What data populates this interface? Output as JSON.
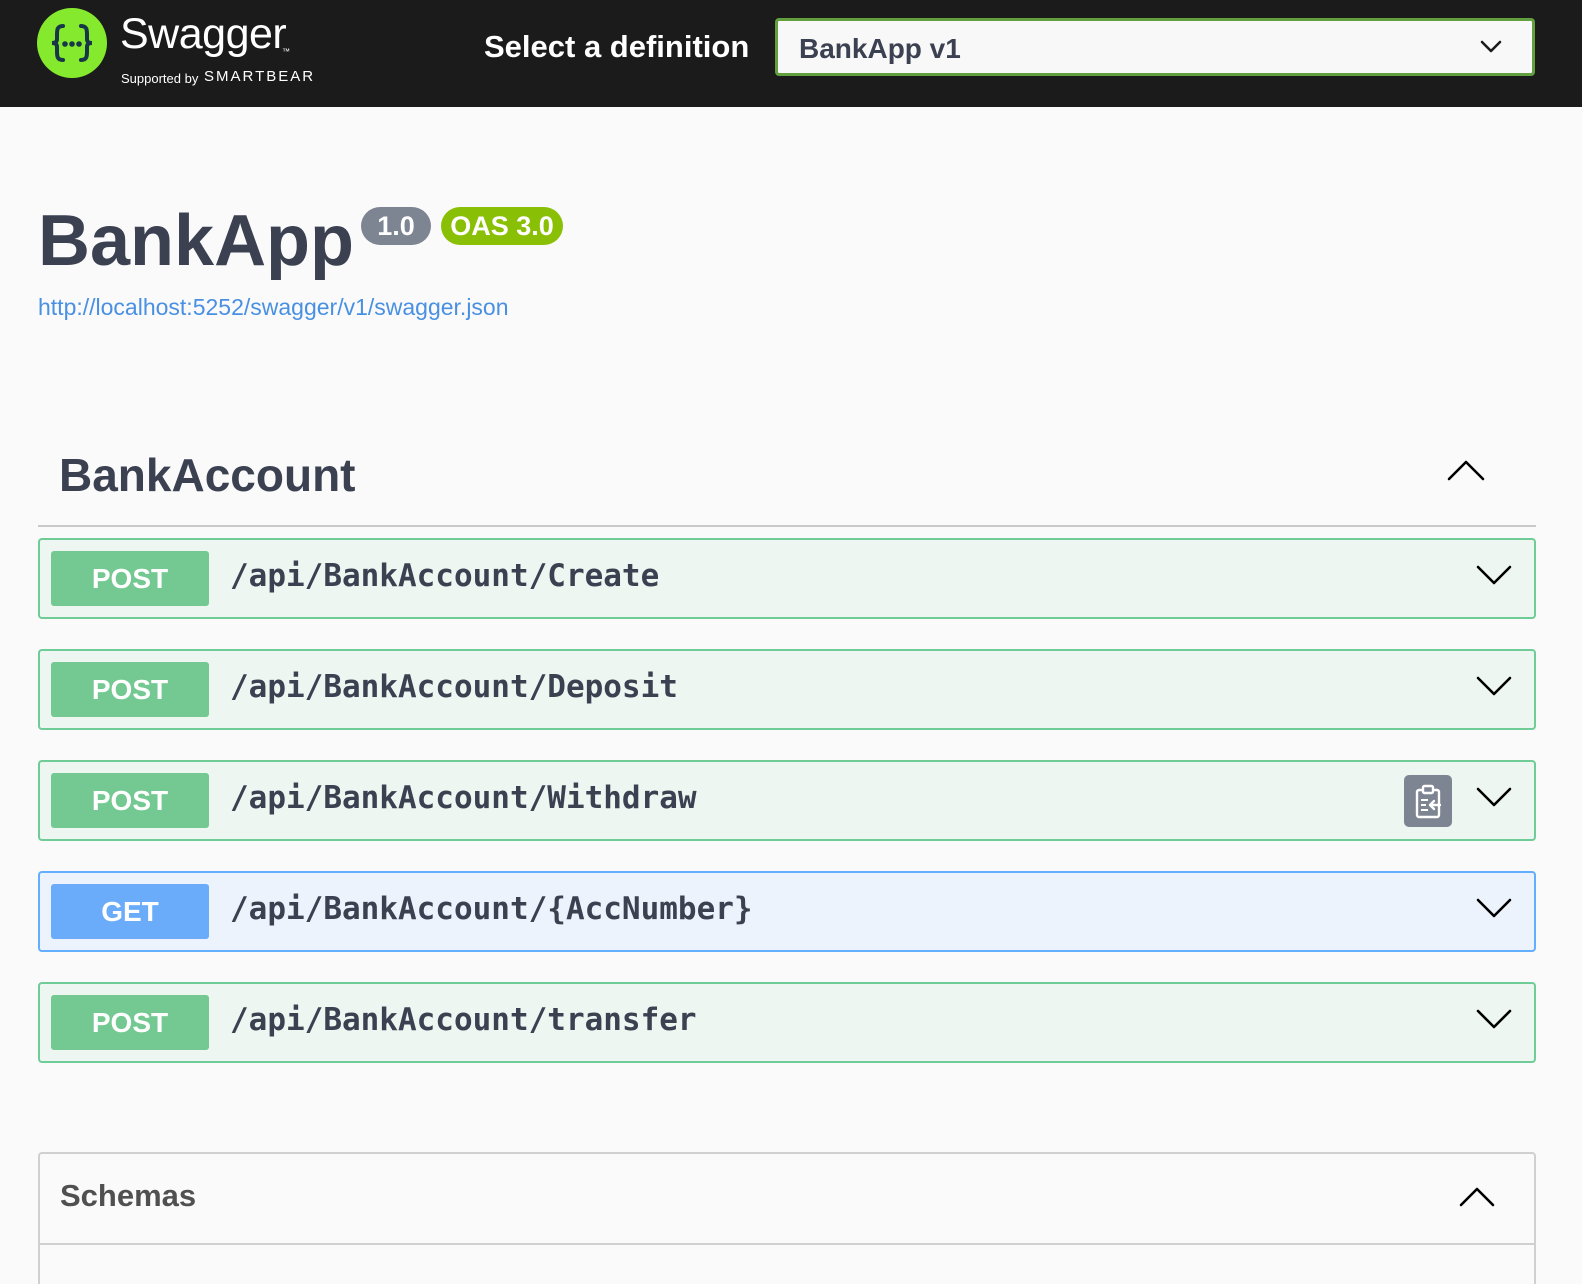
{
  "topbar": {
    "logo": {
      "wordmark": "Swagger",
      "trademark": "™",
      "supported_by": "Supported by",
      "company": "SMARTBEAR"
    },
    "definition_label": "Select a definition",
    "definition_selected": "BankApp v1"
  },
  "info": {
    "title": "BankApp",
    "version": "1.0",
    "oas_version": "OAS 3.0",
    "spec_url": "http://localhost:5252/swagger/v1/swagger.json"
  },
  "tag": {
    "name": "BankAccount",
    "operations": [
      {
        "method": "POST",
        "path": "/api/BankAccount/Create"
      },
      {
        "method": "POST",
        "path": "/api/BankAccount/Deposit"
      },
      {
        "method": "POST",
        "path": "/api/BankAccount/Withdraw"
      },
      {
        "method": "GET",
        "path": "/api/BankAccount/{AccNumber}"
      },
      {
        "method": "POST",
        "path": "/api/BankAccount/transfer"
      }
    ]
  },
  "schemas": {
    "title": "Schemas"
  },
  "colors": {
    "topbar_bg": "#1b1b1b",
    "logo_green": "#85ea2d",
    "post_method": "#73c991",
    "post_bg": "#edf6f1",
    "get_method": "#6aacf9",
    "get_bg": "#ecf3fc",
    "version_badge": "#7d8492",
    "oas_badge": "#89bf04",
    "link": "#4990e2"
  },
  "icons": {
    "op_toggle": "chevron-down-icon",
    "section_toggle": "chevron-up-icon",
    "copy": "copy-to-clipboard-icon"
  }
}
